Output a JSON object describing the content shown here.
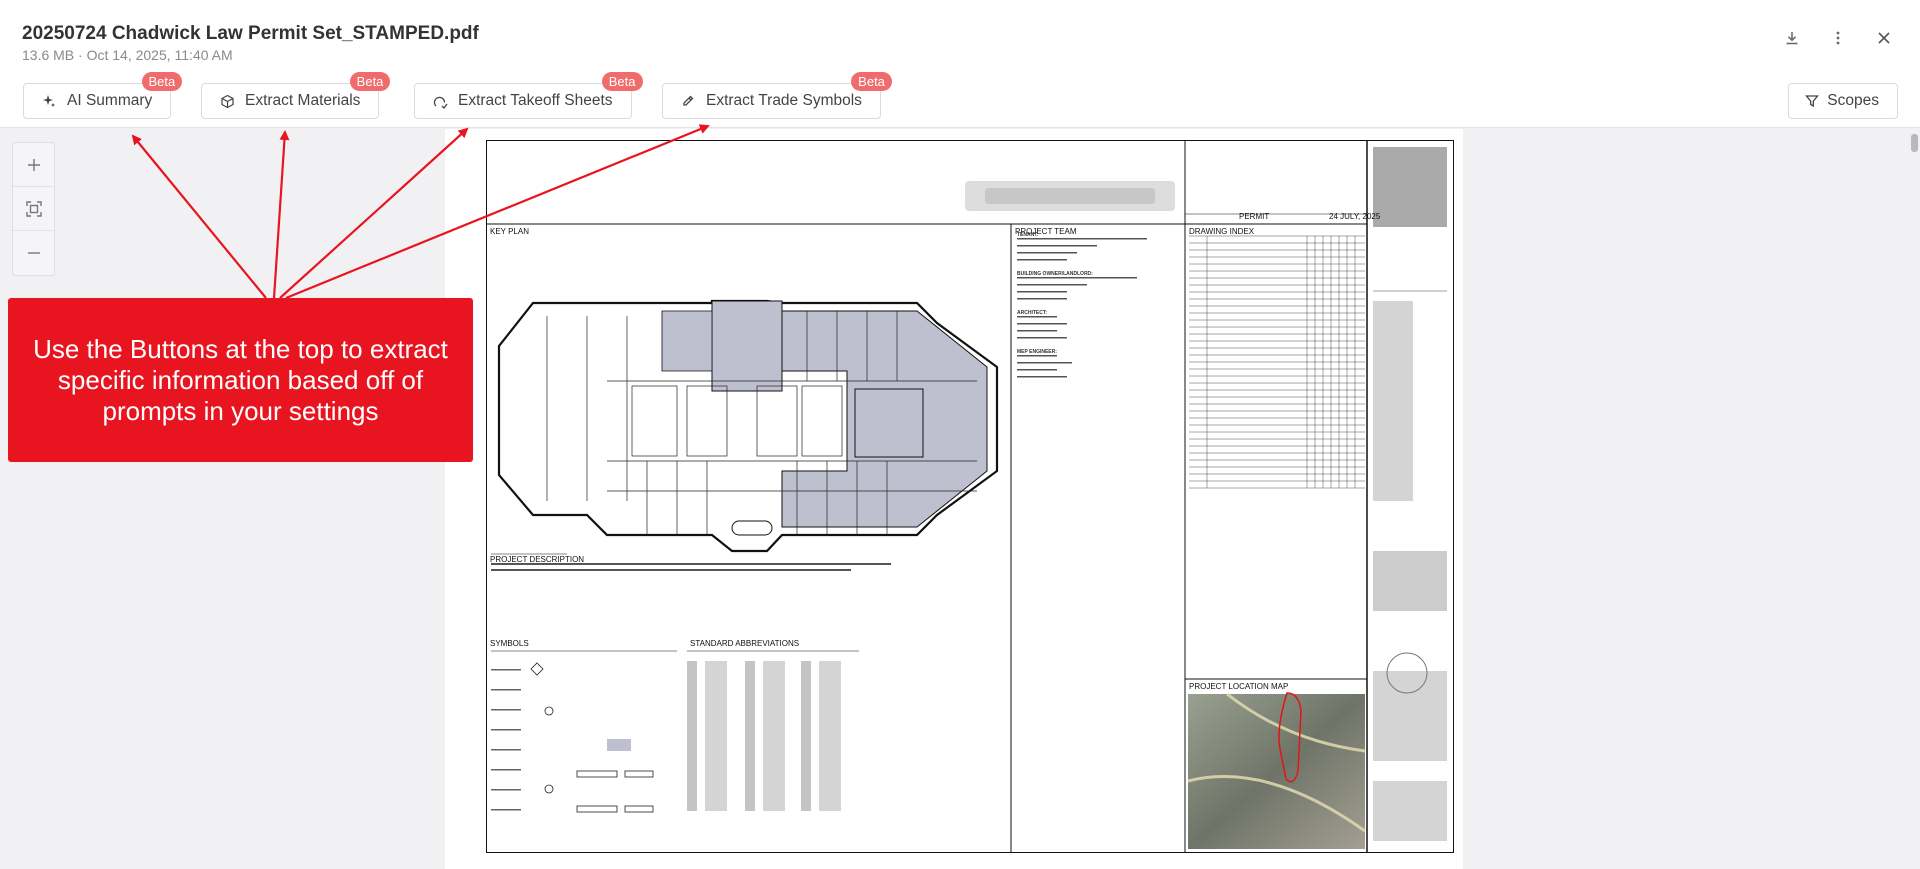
{
  "file": {
    "title": "20250724 Chadwick Law Permit Set_STAMPED.pdf",
    "meta": "13.6 MB · Oct 14, 2025, 11:40 AM"
  },
  "header_icons": [
    "download-icon",
    "more-vertical-icon",
    "close-icon"
  ],
  "actions": [
    {
      "label": "AI Summary",
      "icon": "sparkle-icon",
      "badge": "Beta"
    },
    {
      "label": "Extract Materials",
      "icon": "cube-icon",
      "badge": "Beta"
    },
    {
      "label": "Extract Takeoff Sheets",
      "icon": "takeoff-icon",
      "badge": "Beta"
    },
    {
      "label": "Extract Trade Symbols",
      "icon": "pencil-icon",
      "badge": "Beta"
    }
  ],
  "scopes": {
    "label": "Scopes",
    "icon": "filter-icon"
  },
  "zoom": [
    "zoom-in-icon",
    "fit-screen-icon",
    "zoom-out-icon"
  ],
  "callout": {
    "text": "Use the Buttons at the top to extract specific information based off of prompts in your settings"
  },
  "colors": {
    "accent_red": "#e8141f",
    "beta_badge": "#f06b6b",
    "plan_fill": "#bfc0cf"
  },
  "sheet": {
    "permit": "PERMIT",
    "date": "24 JULY, 2025",
    "key_plan": "KEY PLAN",
    "project_team": "PROJECT TEAM",
    "drawing_index": "DRAWING INDEX",
    "project_description": "PROJECT DESCRIPTION",
    "symbols": "SYMBOLS",
    "standard_abbreviations": "STANDARD ABBREVIATIONS",
    "project_location_map": "PROJECT LOCATION MAP",
    "team": [
      {
        "role": "TENANT:",
        "lines": [
          "CHADWICK, WASHINGTON, MORIARTY, ELMORE & BUNN, P.C.",
          "3201 JERMANTOWN RD",
          "SUITE 600",
          "FAIRFAX, VA 22030"
        ]
      },
      {
        "role": "BUILDING OWNER/LANDLORD:",
        "lines": [
          "JACCESS PROPERTY SERVICES, INC.",
          "10100 MONUMENT DR",
          "SUITE 150",
          "FAIRFAX, VA 22030"
        ]
      },
      {
        "role": "ARCHITECT:",
        "lines": [
          "FORM Architects",
          "1777 N Kent Street",
          "Suite 100",
          "Arlington, VA 22209"
        ]
      },
      {
        "role": "MEP ENGINEER:",
        "lines": [
          "Bowman",
          "13461 Sunrise Valley Dr",
          "Suite 500",
          "Herndon, VA 20171"
        ]
      }
    ]
  }
}
